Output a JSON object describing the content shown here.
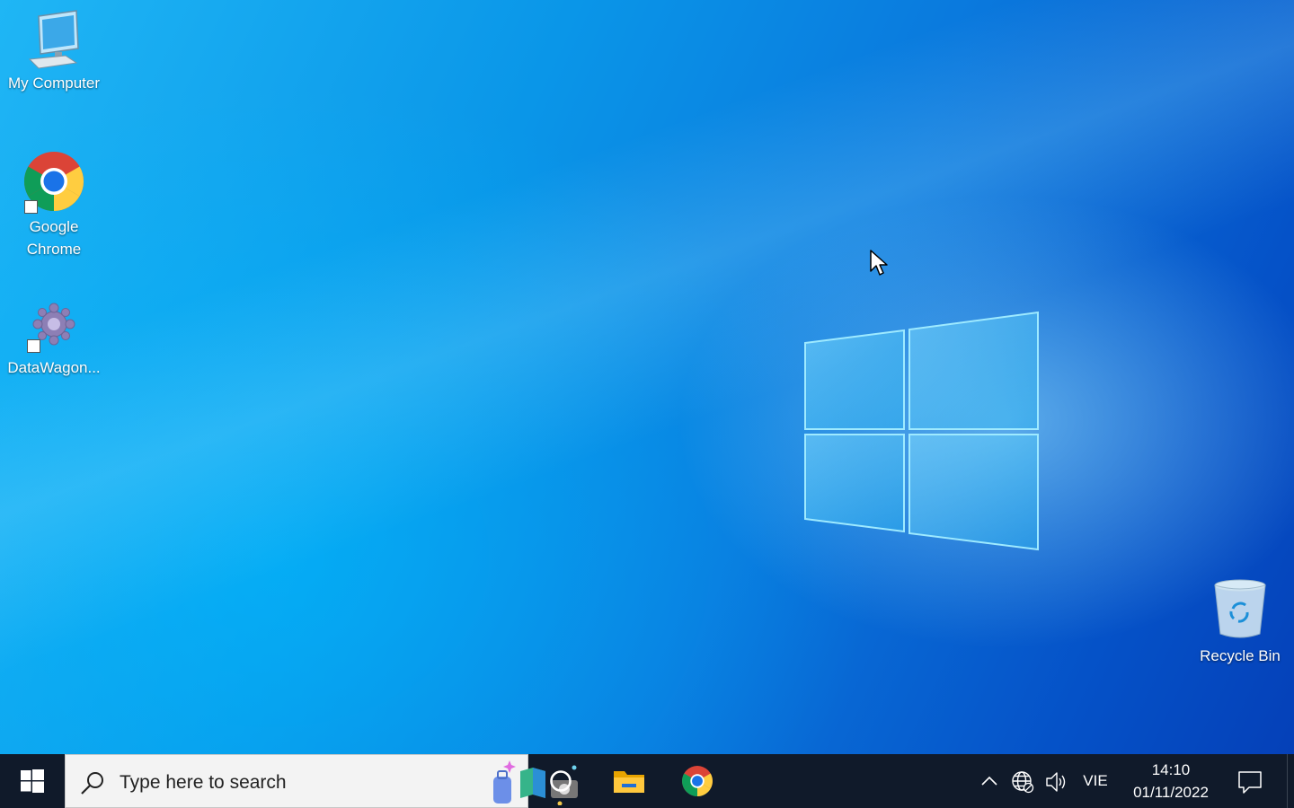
{
  "desktop": {
    "icons": [
      {
        "label": "My Computer",
        "icon": "computer-icon"
      },
      {
        "label": "Google Chrome",
        "icon": "chrome-icon"
      },
      {
        "label": "DataWagon...",
        "icon": "datawagon-icon"
      },
      {
        "label": "Recycle Bin",
        "icon": "recycle-bin-icon"
      }
    ]
  },
  "taskbar": {
    "search": {
      "placeholder": "Type here to search"
    },
    "pinned": [
      {
        "name": "Cortana",
        "icon": "cortana-icon"
      },
      {
        "name": "File Explorer",
        "icon": "file-explorer-icon"
      },
      {
        "name": "Google Chrome",
        "icon": "chrome-icon"
      }
    ],
    "tray": {
      "language": "VIE",
      "time": "14:10",
      "date": "01/11/2022"
    }
  },
  "colors": {
    "taskbar": "#101a2a",
    "accent": "#0a78dd"
  }
}
